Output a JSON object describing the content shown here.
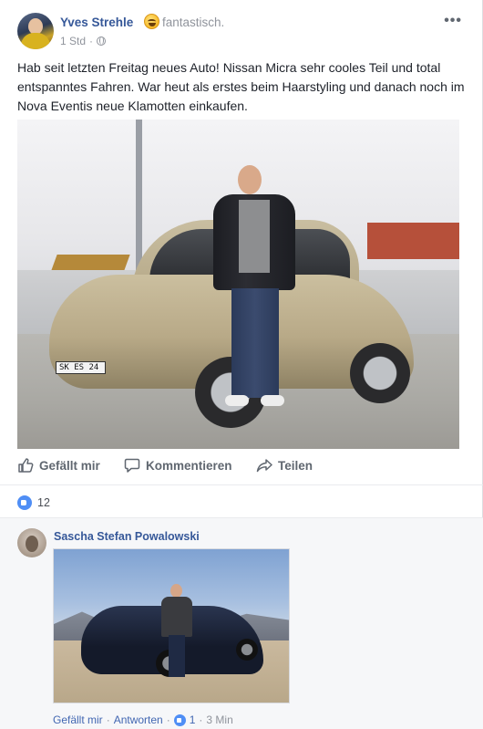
{
  "post": {
    "author": "Yves Strehle",
    "feeling": "fantastisch.",
    "feeling_icon": "grinning-emoji-icon",
    "time": "1 Std",
    "audience_icon": "globe-icon",
    "text": "Hab seit letzten Freitag neues Auto! Nissan Micra sehr cooles Teil und total entspanntes Fahren. War heut als erstes beim Haarstyling und danach noch im Nova Eventis neue Klamotten einkaufen.",
    "photo": {
      "plate_text": "SK ES 24"
    }
  },
  "actions": {
    "like_label": "Gefällt mir",
    "comment_label": "Kommentieren",
    "share_label": "Teilen"
  },
  "reactions": {
    "count": "12"
  },
  "comments": [
    {
      "author": "Sascha Stefan Powalowski",
      "like_label": "Gefällt mir",
      "reply_label": "Antworten",
      "separator": "·",
      "likes": "1",
      "time": "3 Min"
    }
  ],
  "colors": {
    "link_blue": "#365899",
    "meta_gray": "#90949c",
    "like_blue": "#4f8ef5"
  }
}
